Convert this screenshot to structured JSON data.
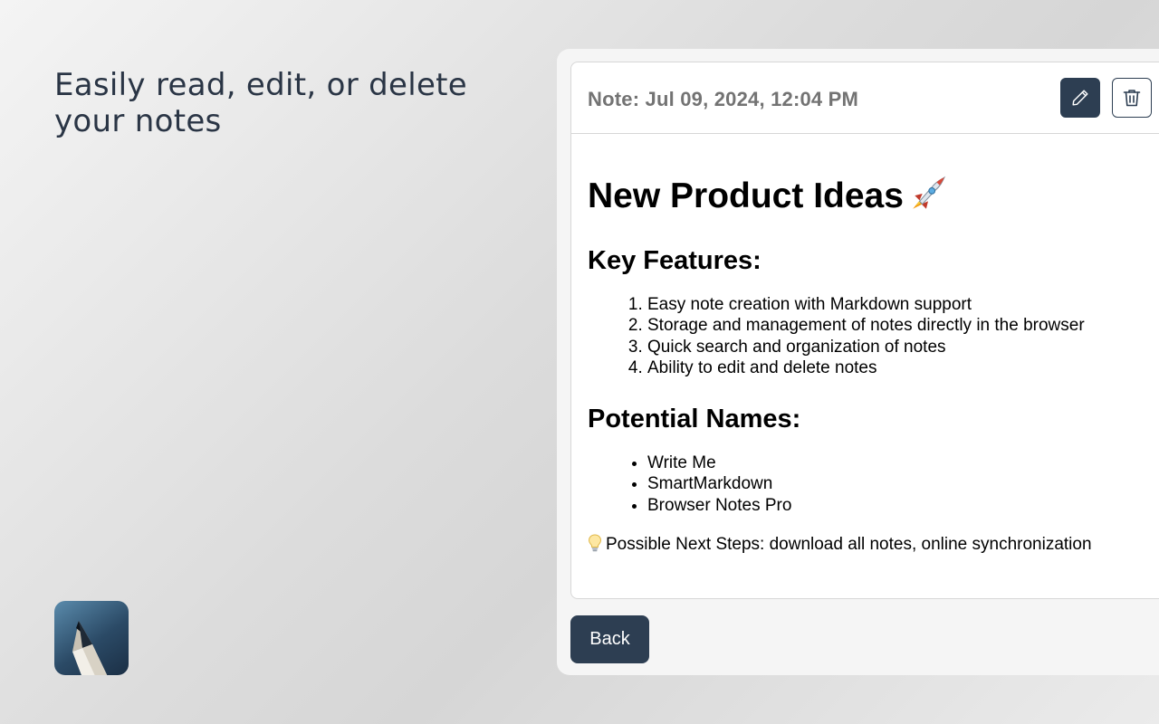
{
  "promo": {
    "headline": "Easily read, edit, or delete your notes",
    "logo_icon": "pen-icon"
  },
  "note": {
    "header_title": "Note: Jul 09, 2024, 12:04 PM",
    "edit_icon": "pencil-icon",
    "delete_icon": "trash-icon",
    "heading": "New Product Ideas",
    "heading_icon": "rocket-icon",
    "sections": [
      {
        "title": "Key Features:",
        "ordered": true,
        "items": [
          "Easy note creation with Markdown support",
          "Storage and management of notes directly in the browser",
          "Quick search and organization of notes",
          "Ability to edit and delete notes"
        ]
      },
      {
        "title": "Potential Names:",
        "ordered": false,
        "items": [
          "Write Me",
          "SmartMarkdown",
          "Browser Notes Pro"
        ]
      }
    ],
    "footer_icon": "lightbulb-icon",
    "footer_text": "Possible Next Steps: download all notes, online synchronization"
  },
  "actions": {
    "back_label": "Back"
  },
  "colors": {
    "accent": "#2d3e52",
    "header_text": "#737373",
    "headline_text": "#2a3545",
    "panel_bg": "#f5f5f5",
    "card_border": "#d7d7d7"
  }
}
